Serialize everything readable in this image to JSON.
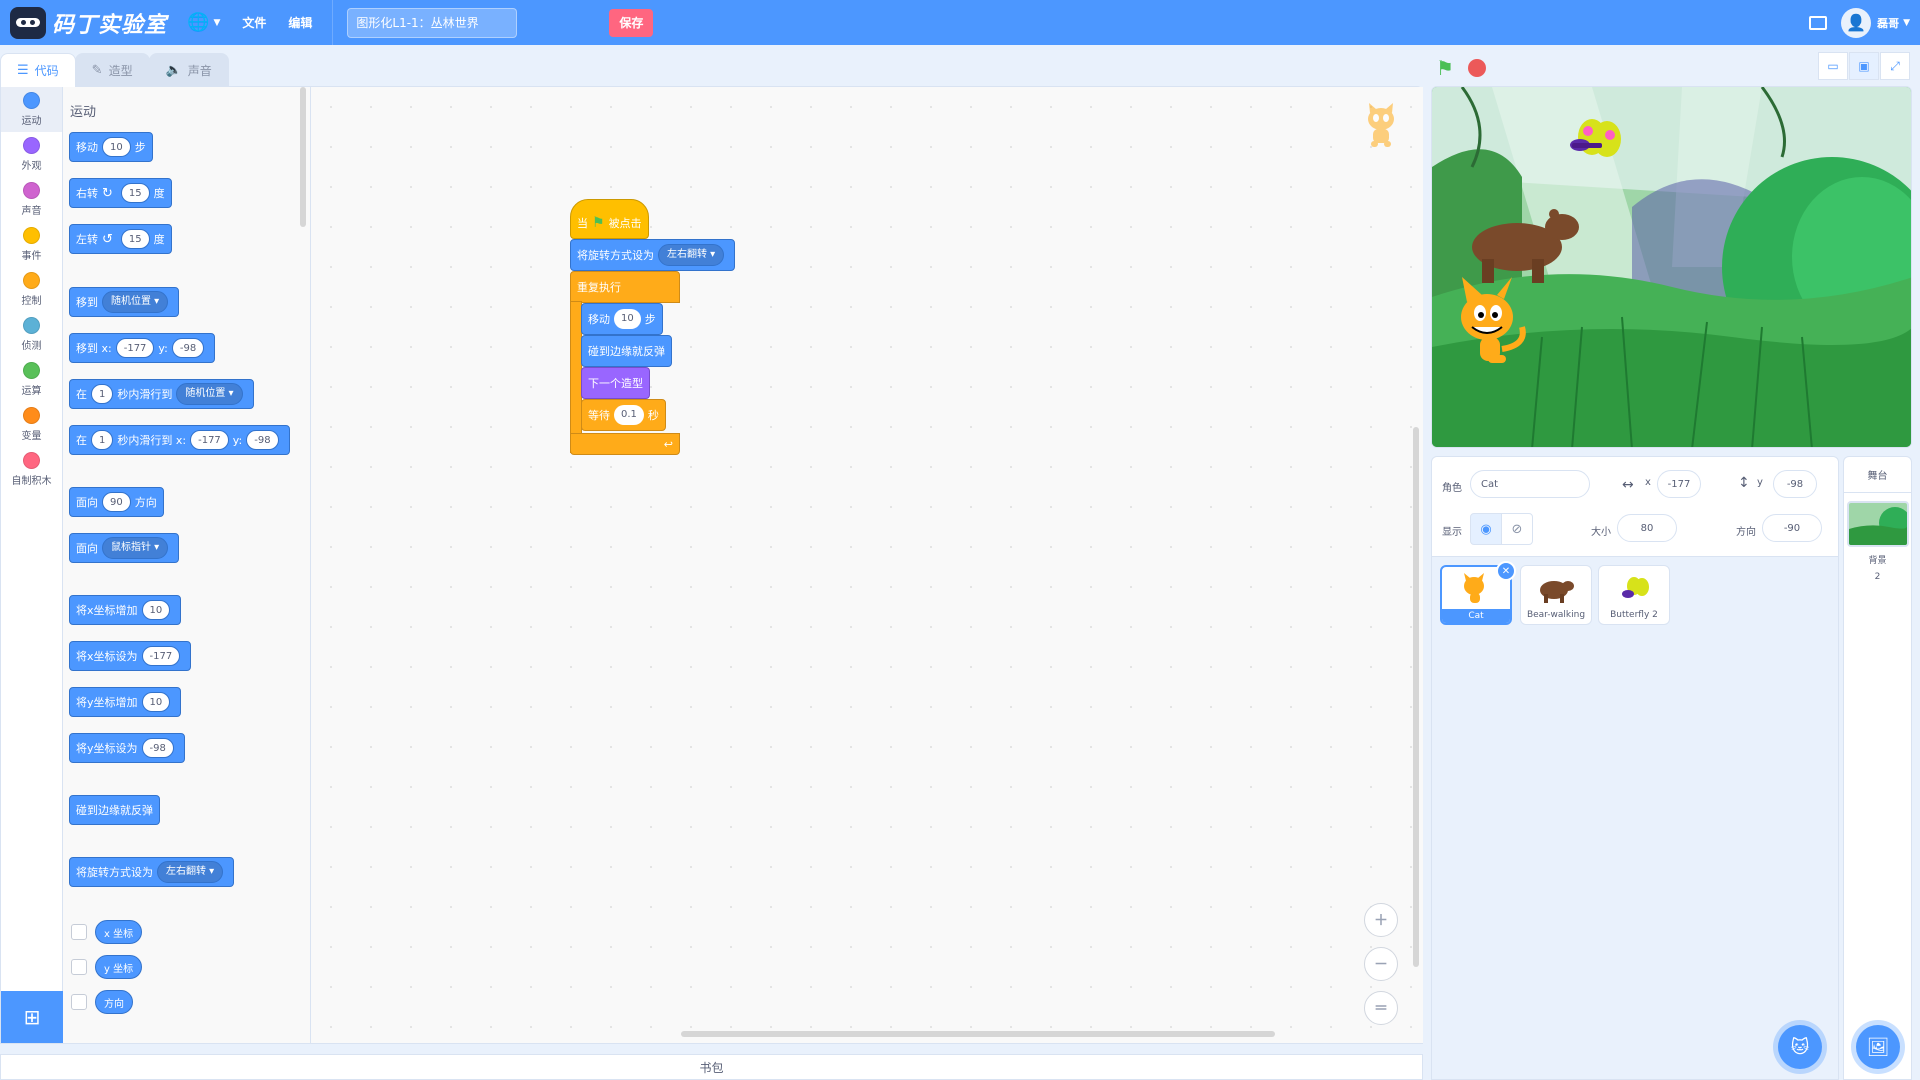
{
  "menubar": {
    "logo_text": "码丁实验室",
    "file_menu": "文件",
    "edit_menu": "编辑",
    "project_title": "图形化L1-1：丛林世界",
    "save_label": "保存",
    "user_name": "磊哥"
  },
  "tabs": [
    {
      "label": "代码"
    },
    {
      "label": "造型"
    },
    {
      "label": "声音"
    }
  ],
  "categories": [
    {
      "label": "运动",
      "color": "#4c97ff"
    },
    {
      "label": "外观",
      "color": "#9966ff"
    },
    {
      "label": "声音",
      "color": "#cf63cf"
    },
    {
      "label": "事件",
      "color": "#ffbf00"
    },
    {
      "label": "控制",
      "color": "#ffab19"
    },
    {
      "label": "侦测",
      "color": "#5cb1d6"
    },
    {
      "label": "运算",
      "color": "#59c059"
    },
    {
      "label": "变量",
      "color": "#ff8c1a"
    },
    {
      "label": "自制积木",
      "color": "#ff6680"
    }
  ],
  "palette": {
    "heading": "运动",
    "move": {
      "label": "移动",
      "value": "10",
      "unit": "步"
    },
    "turn_right": {
      "label": "右转",
      "value": "15",
      "unit": "度"
    },
    "turn_left": {
      "label": "左转",
      "value": "15",
      "unit": "度"
    },
    "goto": {
      "label": "移到",
      "option": "随机位置"
    },
    "goto_xy": {
      "label": "移到 x:",
      "x": "-177",
      "y_label": "y:",
      "y": "-98"
    },
    "glide": {
      "label_a": "在",
      "secs": "1",
      "label_b": "秒内滑行到",
      "option": "随机位置"
    },
    "glide_xy": {
      "label_a": "在",
      "secs": "1",
      "label_b": "秒内滑行到 x:",
      "x": "-177",
      "y_label": "y:",
      "y": "-98"
    },
    "point_dir": {
      "label_a": "面向",
      "value": "90",
      "label_b": "方向"
    },
    "point_towards": {
      "label": "面向",
      "option": "鼠标指针"
    },
    "change_x": {
      "label": "将x坐标增加",
      "value": "10"
    },
    "set_x": {
      "label": "将x坐标设为",
      "value": "-177"
    },
    "change_y": {
      "label": "将y坐标增加",
      "value": "10"
    },
    "set_y": {
      "label": "将y坐标设为",
      "value": "-98"
    },
    "bounce": {
      "label": "碰到边缘就反弹"
    },
    "rot_style": {
      "label": "将旋转方式设为",
      "option": "左右翻转"
    },
    "rep_x": "x 坐标",
    "rep_y": "y 坐标",
    "rep_dir": "方向"
  },
  "script": {
    "hat_a": "当",
    "hat_b": "被点击",
    "rot_label": "将旋转方式设为",
    "rot_option": "左右翻转",
    "forever": "重复执行",
    "move_label": "移动",
    "move_value": "10",
    "move_unit": "步",
    "bounce": "碰到边缘就反弹",
    "next_costume": "下一个造型",
    "wait_label": "等待",
    "wait_value": "0.1",
    "wait_unit": "秒"
  },
  "backpack_label": "书包",
  "sprite_info": {
    "sprite_label": "角色",
    "sprite_name": "Cat",
    "x_label": "x",
    "x_value": "-177",
    "y_label": "y",
    "y_value": "-98",
    "show_label": "显示",
    "size_label": "大小",
    "size_value": "80",
    "direction_label": "方向",
    "direction_value": "-90"
  },
  "sprites": [
    {
      "name": "Cat",
      "selected": true
    },
    {
      "name": "Bear-walking",
      "selected": false
    },
    {
      "name": "Butterfly 2",
      "selected": false
    }
  ],
  "stage_pane": {
    "title": "舞台",
    "backdrops_label": "背景",
    "backdrops_count": "2"
  }
}
